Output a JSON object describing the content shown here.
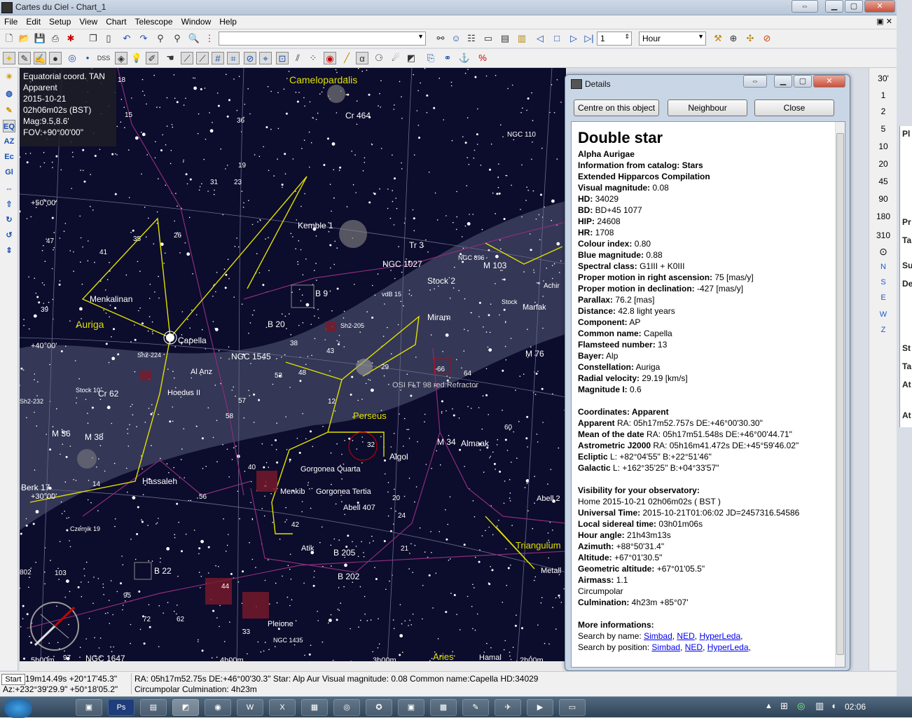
{
  "window": {
    "title": "Cartes du Ciel - Chart_1"
  },
  "menu": [
    "File",
    "Edit",
    "Setup",
    "View",
    "Chart",
    "Telescope",
    "Window",
    "Help"
  ],
  "toolbar1": {
    "step_value": "1",
    "time_unit": "Hour"
  },
  "toolbar2": {
    "dss_label": "DSS"
  },
  "left_toolbar": [
    "EQ",
    "AZ",
    "Ec",
    "Gl"
  ],
  "right_toolbar": [
    "30'",
    "1",
    "2",
    "5",
    "10",
    "20",
    "45",
    "90",
    "180",
    "310",
    "N",
    "S",
    "E",
    "W",
    "Z"
  ],
  "chart_info": {
    "line1": "Equatorial coord. TAN",
    "line2": "Apparent",
    "line3": "2015-10-21",
    "line4": "02h06m02s (BST)",
    "line5": "Mag:9.5,8.6'",
    "line6": "FOV:+90°00'00\""
  },
  "chart_labels": {
    "camelopardalis": "Camelopardalis",
    "cr464": "Cr 464",
    "ngc110": "NGC 110",
    "kemble1": "Kemble 1",
    "tr3": "Tr 3",
    "ngc1027": "NGC 1027",
    "ngc896": "NGC 896",
    "stock2": "Stock 2",
    "m103": "M 103",
    "achir": "Achir",
    "marfak": "Marfak",
    "stock": "Stock",
    "vdb15": "vdB 15",
    "b9": "B 9",
    "miram": "Miram",
    "menkalinan": "Menkalinan",
    "auriga": "Auriga",
    "capella": "Capella",
    "b20": "B 20",
    "sh2205": "Sh2-205",
    "sh2224": "Sh2-224",
    "ngc1545": "NGC 1545",
    "alanz": "Al Anz",
    "hoedus": "Hoedus II",
    "stock10": "Stock 10",
    "cr62": "Cr 62",
    "sh2232": "Sh2-232",
    "osi": "OSI FLT 98 red:Refractor",
    "perseus": "Perseus",
    "m76": "M 76",
    "m36": "M 36",
    "m38": "M 38",
    "m34": "M 34",
    "almaak": "Almaak",
    "algol": "Algol",
    "gorgonea_quarta": "Gorgonea Quarta",
    "gorgonea_tertia": "Gorgonea Tertia",
    "menkib": "Menkib",
    "abell407": "Abell 407",
    "abell2": "Abell 2",
    "hassaleh": "Hassaleh",
    "berk17": "Berk 17",
    "czernik19": "Czernik 19",
    "atik": "Atik",
    "b205": "B 205",
    "b202": "B 202",
    "b22": "B 22",
    "triangulum": "Triangulum",
    "metall": "Metall",
    "pleione": "Pleione",
    "ngc1435": "NGC 1435",
    "ngc1647": "NGC 1647",
    "aries": "Aries",
    "hamal": "Hamal",
    "dec50": "+50°00'",
    "dec40": "+40°00'",
    "dec30": "+30°00'",
    "ra5": "5h00m",
    "ra4": "4h00m",
    "ra3": "3h00m",
    "ra2": "2h00m",
    "n18": "18",
    "n36": "36",
    "n15": "15",
    "n19": "19",
    "n31": "31",
    "n23": "23",
    "n47": "47",
    "n35": "35",
    "n41": "41",
    "n26": "26",
    "n39": "39",
    "n48": "48",
    "n53": "53",
    "n58": "58",
    "n57": "57",
    "n29": "29",
    "n43": "43",
    "n66": "66",
    "n64": "64",
    "n60": "60",
    "n32": "32",
    "n40": "40",
    "n56": "56",
    "n20": "20",
    "n24": "24",
    "n42": "42",
    "n21": "21",
    "n44": "44",
    "n95": "95",
    "n103": "103",
    "n802": "802",
    "n33": "33",
    "n62": "62",
    "n72": "72",
    "n97": "97",
    "n14": "14",
    "n12": "12",
    "n38": "38"
  },
  "details": {
    "title": "Details",
    "buttons": {
      "centre": "Centre on this object",
      "neighbour": "Neighbour",
      "close": "Close"
    },
    "heading": "Double star",
    "name": "Alpha Aurigae",
    "catalog": "Information from catalog: Stars",
    "compilation": "Extended Hipparcos Compilation",
    "rows": [
      {
        "label": "Visual magnitude:",
        "value": "0.08"
      },
      {
        "label": "HD:",
        "value": "34029"
      },
      {
        "label": "BD:",
        "value": "BD+45 1077"
      },
      {
        "label": "HIP:",
        "value": "24608"
      },
      {
        "label": "HR:",
        "value": "1708"
      },
      {
        "label": "Colour index:",
        "value": "0.80"
      },
      {
        "label": "Blue magnitude:",
        "value": "0.88"
      },
      {
        "label": "Spectral class:",
        "value": "G1III + K0III"
      },
      {
        "label": "Proper motion in right ascension:",
        "value": "75 [mas/y]"
      },
      {
        "label": "Proper motion in declination:",
        "value": "-427 [mas/y]"
      },
      {
        "label": "Parallax:",
        "value": "76.2 [mas]"
      },
      {
        "label": "Distance:",
        "value": "42.8 light years"
      },
      {
        "label": "Component:",
        "value": "AP"
      },
      {
        "label": "Common name:",
        "value": "Capella"
      },
      {
        "label": "Flamsteed number:",
        "value": "13"
      },
      {
        "label": "Bayer:",
        "value": "Alp"
      },
      {
        "label": "Constellation:",
        "value": "Auriga"
      },
      {
        "label": "Radial velocity:",
        "value": "29.19 [km/s]"
      },
      {
        "label": "Magnitude I:",
        "value": "0.6"
      }
    ],
    "coord_title": "Coordinates: Apparent",
    "coords": [
      {
        "label": "Apparent",
        "value": "RA: 05h17m52.757s DE:+46°00'30.30\""
      },
      {
        "label": "Mean of the date",
        "value": "RA: 05h17m51.548s DE:+46°00'44.71\""
      },
      {
        "label": "Astrometric J2000",
        "value": "RA: 05h16m41.472s DE:+45°59'46.02\""
      },
      {
        "label": "Ecliptic",
        "value": "L: +82°04'55\" B:+22°51'46\""
      },
      {
        "label": "Galactic",
        "value": "L: +162°35'25\" B:+04°33'57\""
      }
    ],
    "vis_title": "Visibility for your observatory:",
    "vis_home": "Home 2015-10-21 02h06m02s ( BST )",
    "vis_rows": [
      {
        "label": "Universal Time:",
        "value": "2015-10-21T01:06:02 JD=2457316.54586"
      },
      {
        "label": "Local sidereal time:",
        "value": "03h01m06s"
      },
      {
        "label": "Hour angle:",
        "value": "21h43m13s"
      },
      {
        "label": "Azimuth:",
        "value": "+88°50'31.4\""
      },
      {
        "label": "Altitude:",
        "value": "+67°01'30.5\""
      },
      {
        "label": "Geometric altitude:",
        "value": "+67°01'05.5\""
      },
      {
        "label": "Airmass:",
        "value": "1.1"
      }
    ],
    "circumpolar": "Circumpolar",
    "culmination_label": "Culmination:",
    "culmination_value": "4h23m +85°07'",
    "more_title": "More informations:",
    "search_name": "Search by name:",
    "search_pos": "Search by position:",
    "link_simbad": "Simbad",
    "link_ned": "NED",
    "link_hyperleda": "HyperLeda"
  },
  "right_window": [
    "Pl",
    "Pr",
    "Ta",
    "Su",
    "De",
    "St",
    "Ta",
    "At",
    "At"
  ],
  "status": {
    "left1": "19m14.49s +20°17'45.3\"",
    "left2": "Az:+232°39'29.9\" +50°18'05.2\"",
    "main1": "RA: 05h17m52.75s DE:+46°00'30.3\"  Star: Alp Aur  Visual magnitude:  0.08  Common name:Capella  HD:34029",
    "main2": "Circumpolar   Culmination:  4h23m"
  },
  "taskbar": {
    "start_tip": "Start",
    "clock": "02:06"
  }
}
